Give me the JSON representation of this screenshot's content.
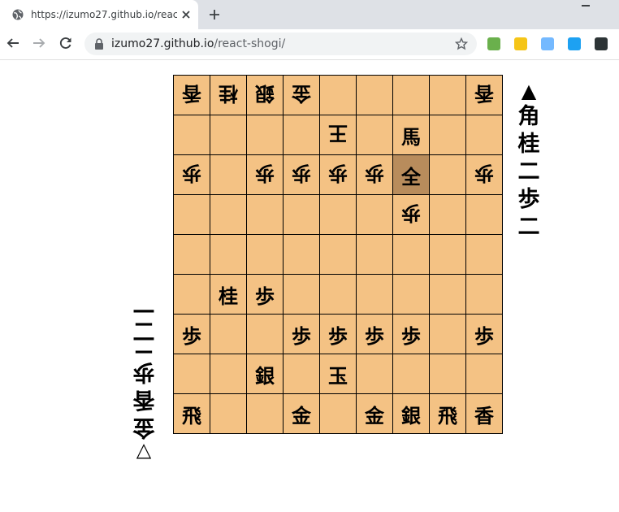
{
  "browser": {
    "tab_title": "https://izumo27.github.io/react-s",
    "url_host": "izumo27.github.io",
    "url_path": "/react-shogi/",
    "extensions": [
      {
        "name": "green-ext-icon",
        "color": "#6ab04c"
      },
      {
        "name": "flag-ext-icon",
        "color": "#f5c518"
      },
      {
        "name": "feather-ext-icon",
        "color": "#74b9ff"
      },
      {
        "name": "twitter-ext-icon",
        "color": "#1da1f2"
      },
      {
        "name": "dark-ext-icon",
        "color": "#2d3436"
      }
    ]
  },
  "colors": {
    "board": "#f4c284",
    "selected": "#b88c5c"
  },
  "board": [
    [
      {
        "p": "香",
        "g": 1
      },
      {
        "p": "桂",
        "g": 1
      },
      {
        "p": "銀",
        "g": 1
      },
      {
        "p": "金",
        "g": 1
      },
      {
        "p": ""
      },
      {
        "p": ""
      },
      {
        "p": ""
      },
      {
        "p": ""
      },
      {
        "p": "香",
        "g": 1
      }
    ],
    [
      {
        "p": ""
      },
      {
        "p": ""
      },
      {
        "p": ""
      },
      {
        "p": ""
      },
      {
        "p": "王",
        "g": 1
      },
      {
        "p": ""
      },
      {
        "p": "馬",
        "g": 0
      },
      {
        "p": ""
      },
      {
        "p": ""
      }
    ],
    [
      {
        "p": "歩",
        "g": 1
      },
      {
        "p": ""
      },
      {
        "p": "歩",
        "g": 1
      },
      {
        "p": "歩",
        "g": 1
      },
      {
        "p": "歩",
        "g": 1
      },
      {
        "p": "歩",
        "g": 1
      },
      {
        "p": "全",
        "g": 0,
        "sel": 1
      },
      {
        "p": ""
      },
      {
        "p": "歩",
        "g": 1
      }
    ],
    [
      {
        "p": ""
      },
      {
        "p": ""
      },
      {
        "p": ""
      },
      {
        "p": ""
      },
      {
        "p": ""
      },
      {
        "p": ""
      },
      {
        "p": "歩",
        "g": 1
      },
      {
        "p": ""
      },
      {
        "p": ""
      }
    ],
    [
      {
        "p": ""
      },
      {
        "p": ""
      },
      {
        "p": ""
      },
      {
        "p": ""
      },
      {
        "p": ""
      },
      {
        "p": ""
      },
      {
        "p": ""
      },
      {
        "p": ""
      },
      {
        "p": ""
      }
    ],
    [
      {
        "p": ""
      },
      {
        "p": "桂",
        "g": 0
      },
      {
        "p": "歩",
        "g": 0
      },
      {
        "p": ""
      },
      {
        "p": ""
      },
      {
        "p": ""
      },
      {
        "p": ""
      },
      {
        "p": ""
      },
      {
        "p": ""
      }
    ],
    [
      {
        "p": "歩",
        "g": 0
      },
      {
        "p": ""
      },
      {
        "p": ""
      },
      {
        "p": "歩",
        "g": 0
      },
      {
        "p": "歩",
        "g": 0
      },
      {
        "p": "歩",
        "g": 0
      },
      {
        "p": "歩",
        "g": 0
      },
      {
        "p": ""
      },
      {
        "p": "歩",
        "g": 0
      }
    ],
    [
      {
        "p": ""
      },
      {
        "p": ""
      },
      {
        "p": "銀",
        "g": 0
      },
      {
        "p": ""
      },
      {
        "p": "玉",
        "g": 0
      },
      {
        "p": ""
      },
      {
        "p": ""
      },
      {
        "p": ""
      },
      {
        "p": ""
      }
    ],
    [
      {
        "p": "飛",
        "g": 0
      },
      {
        "p": ""
      },
      {
        "p": ""
      },
      {
        "p": "金",
        "g": 0
      },
      {
        "p": ""
      },
      {
        "p": "金",
        "g": 0
      },
      {
        "p": "銀",
        "g": 0
      },
      {
        "p": "飛",
        "g": 0
      },
      {
        "p": "香",
        "g": 0
      }
    ]
  ],
  "sente_hand": {
    "mark": "▲",
    "pieces": [
      "角",
      "桂",
      "二",
      "歩",
      "二"
    ]
  },
  "gote_hand": {
    "mark": "▽",
    "pieces": [
      "金",
      "香",
      "歩",
      "二",
      "二"
    ]
  }
}
